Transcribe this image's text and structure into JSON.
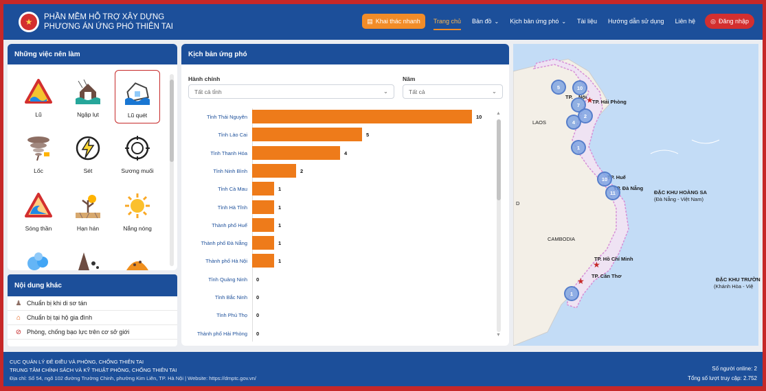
{
  "header": {
    "brand_line1": "PHẦN MỀM HỖ TRỢ XÂY DỰNG",
    "brand_line2": "PHƯƠNG ÁN ỨNG PHÓ THIÊN TAI",
    "quick_btn": "Khai thác nhanh",
    "nav": {
      "home": "Trang chủ",
      "map": "Bản đồ",
      "scenario": "Kịch bản ứng phó",
      "docs": "Tài liệu",
      "guide": "Hướng dẫn sử dụng",
      "contact": "Liên hệ"
    },
    "login": "Đăng nhập"
  },
  "todo": {
    "title": "Những việc nên làm",
    "items": [
      {
        "label": "Lũ",
        "icon": "flood-warning-icon"
      },
      {
        "label": "Ngập lụt",
        "icon": "inundation-icon"
      },
      {
        "label": "Lũ quét",
        "icon": "flash-flood-icon"
      },
      {
        "label": "Lốc",
        "icon": "tornado-icon"
      },
      {
        "label": "Sét",
        "icon": "lightning-icon"
      },
      {
        "label": "Sương muối",
        "icon": "frost-icon"
      },
      {
        "label": "Sóng thần",
        "icon": "tsunami-icon"
      },
      {
        "label": "Hạn hán",
        "icon": "drought-icon"
      },
      {
        "label": "Nắng nóng",
        "icon": "heatwave-icon"
      }
    ]
  },
  "other": {
    "title": "Nội dung khác",
    "items": [
      {
        "label": "Chuẩn bị khi di sơ tán"
      },
      {
        "label": "Chuẩn bị tại hộ gia đình"
      },
      {
        "label": "Phòng, chống bạo lực trên cơ sở giới"
      }
    ]
  },
  "scenario": {
    "title": "Kịch bản ứng phó",
    "filter_admin_label": "Hành chính",
    "filter_admin_value": "Tất cả tỉnh",
    "filter_year_label": "Năm",
    "filter_year_value": "Tất cả"
  },
  "chart_data": {
    "type": "bar",
    "orientation": "horizontal",
    "categories": [
      "Tỉnh Thái Nguyên",
      "Tỉnh Lào Cai",
      "Tỉnh Thanh Hóa",
      "Tỉnh Ninh Bình",
      "Tỉnh Cà Mau",
      "Tỉnh Hà Tĩnh",
      "Thành phố Huế",
      "Thành phố Đà Nẵng",
      "Thành phố Hà Nội",
      "Tỉnh Quảng Ninh",
      "Tỉnh Bắc Ninh",
      "Tỉnh Phú Thọ",
      "Thành phố Hải Phòng"
    ],
    "values": [
      10,
      5,
      4,
      2,
      1,
      1,
      1,
      1,
      1,
      0,
      0,
      0,
      0
    ],
    "xlim": [
      0,
      10
    ],
    "color": "#ee7b1a"
  },
  "map": {
    "labels": {
      "laos": "LAOS",
      "cambodia": "CAMBODIA",
      "d": "D",
      "hanoi": "Nội",
      "hanoi_prefix": "TP.",
      "haiphong": "TP. Hải Phòng",
      "hue": "TP. Huế",
      "danang": "TP. Đà Nẵng",
      "hoangsa1": "ĐẶC KHU HOÀNG SA",
      "hoangsa2": "(Đà Nẵng - Việt Nam)",
      "hcm": "TP. Hồ Chí Minh",
      "cantho": "TP. Cần Thơ",
      "truongsa1": "ĐẶC KHU TRƯỜN",
      "truongsa2": "(Khánh Hòa - Việ"
    },
    "clusters": [
      "5",
      "10",
      "7",
      "4",
      "2",
      "1",
      "10",
      "11",
      "1"
    ]
  },
  "footer": {
    "line1": "CỤC QUẢN LÝ ĐÊ ĐIỀU VÀ PHÒNG, CHỐNG THIÊN TAI",
    "line2": "TRUNG TÂM CHÍNH SÁCH VÀ KỸ THUẬT PHÒNG, CHỐNG THIÊN TAI",
    "line3": "Địa chỉ: Số 54, ngõ 102 đường Trường Chinh, phường Kim Liên, TP. Hà Nội | Website: https://dmptc.gov.vn/",
    "online": "Số người online: 2",
    "visits": "Tổng số lượt truy cập: 2.752"
  }
}
